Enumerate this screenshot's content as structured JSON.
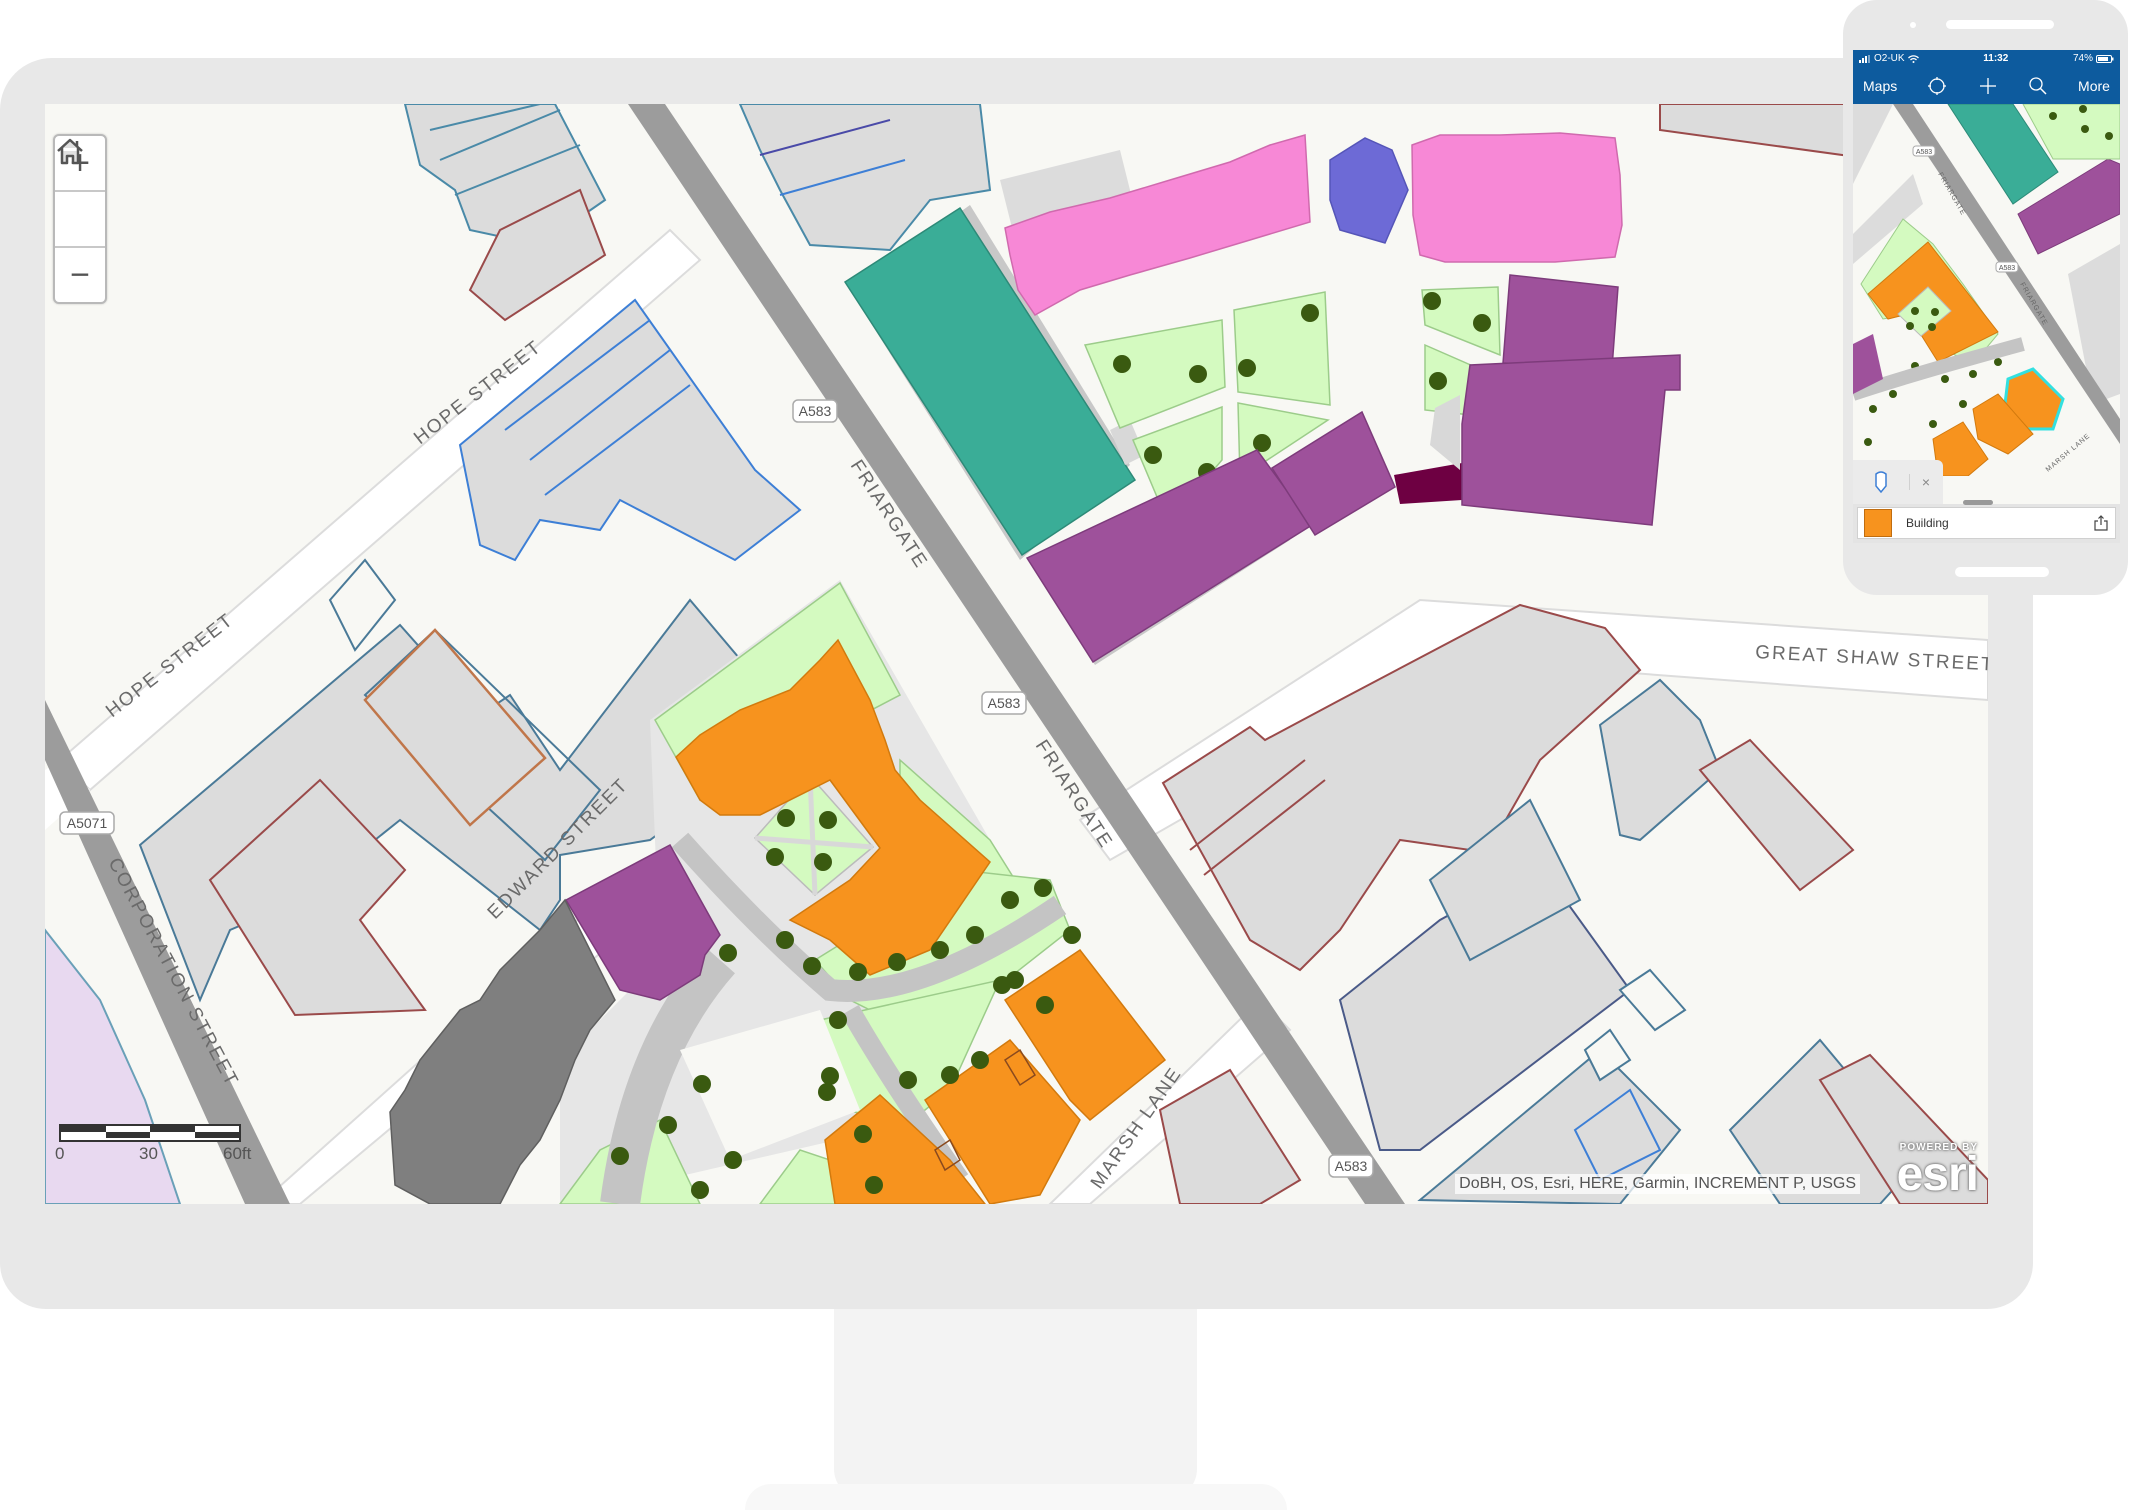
{
  "desktop_map": {
    "zoom_in_label": "+",
    "zoom_out_label": "−",
    "home_label": "Default map view",
    "streets": {
      "hope_street_1": "HOPE STREET",
      "hope_street_2": "HOPE STREET",
      "friargate_1": "FRIARGATE",
      "friargate_2": "FRIARGATE",
      "corporation_street": "CORPORATION STREET",
      "edward_street": "EDWARD STREET",
      "marsh_lane": "MARSH LANE",
      "great_shaw_street": "GREAT SHAW STREET"
    },
    "road_shields": {
      "a583_1": "A583",
      "a583_2": "A583",
      "a583_3": "A583",
      "a5071": "A5071"
    },
    "scale_bar": {
      "labels": [
        "0",
        "30",
        "60ft"
      ]
    },
    "attribution": "DoBH, OS, Esri, HERE, Garmin, INCREMENT P, USGS",
    "logo": {
      "powered_by": "POWERED BY",
      "name": "esri"
    }
  },
  "phone": {
    "status": {
      "carrier": "O2-UK",
      "time": "11:32",
      "battery": "74%"
    },
    "nav": {
      "maps_label": "Maps",
      "more_label": "More"
    },
    "map": {
      "road_shields": [
        "A583",
        "A583"
      ],
      "streets": {
        "friargate_1": "FRIARGATE",
        "friargate_2": "FRIARGATE",
        "marsh_lane": "MARSH LANE"
      }
    },
    "popup": {
      "close_label": "×",
      "feature_label": "Building"
    }
  },
  "colors": {
    "residential_orange": "#f7931e",
    "teal": "#3aad97",
    "purple": "#9e519b",
    "dark_purple": "#6e0042",
    "pink": "#f788d6",
    "blue_hex": "#6d6ad6",
    "park_green": "#d4fac0",
    "tree_green": "#3a5a10",
    "phone_bar_blue": "#0d5b9e",
    "selection_cyan": "#33e0e0"
  }
}
